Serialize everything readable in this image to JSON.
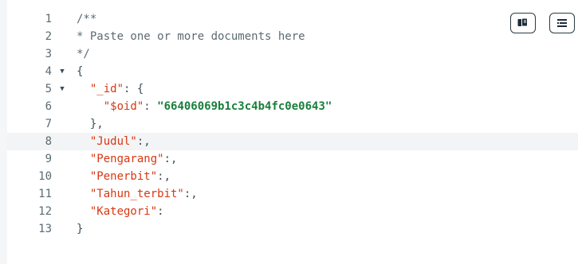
{
  "editor": {
    "active_line": 8,
    "lines": [
      {
        "num": "1",
        "fold": "",
        "parts": [
          {
            "t": "/**",
            "c": "cm"
          }
        ]
      },
      {
        "num": "2",
        "fold": "",
        "parts": [
          {
            "t": "* Paste one or more documents here",
            "c": "cm"
          }
        ]
      },
      {
        "num": "3",
        "fold": "",
        "parts": [
          {
            "t": "*/",
            "c": "cm"
          }
        ]
      },
      {
        "num": "4",
        "fold": "▼",
        "parts": [
          {
            "t": "{",
            "c": "punc"
          }
        ]
      },
      {
        "num": "5",
        "fold": "▼",
        "parts": [
          {
            "t": "  ",
            "c": "punc"
          },
          {
            "t": "\"_id\"",
            "c": "key"
          },
          {
            "t": ": {",
            "c": "punc"
          }
        ]
      },
      {
        "num": "6",
        "fold": "",
        "parts": [
          {
            "t": "    ",
            "c": "punc"
          },
          {
            "t": "\"$oid\"",
            "c": "key"
          },
          {
            "t": ": ",
            "c": "punc"
          },
          {
            "t": "\"66406069b1c3c4b4fc0e0643\"",
            "c": "str"
          }
        ]
      },
      {
        "num": "7",
        "fold": "",
        "parts": [
          {
            "t": "  },",
            "c": "punc"
          }
        ]
      },
      {
        "num": "8",
        "fold": "",
        "parts": [
          {
            "t": "  ",
            "c": "punc"
          },
          {
            "t": "\"Judul\"",
            "c": "key"
          },
          {
            "t": ":,",
            "c": "punc"
          }
        ]
      },
      {
        "num": "9",
        "fold": "",
        "parts": [
          {
            "t": "  ",
            "c": "punc"
          },
          {
            "t": "\"Pengarang\"",
            "c": "key"
          },
          {
            "t": ":,",
            "c": "punc"
          }
        ]
      },
      {
        "num": "10",
        "fold": "",
        "parts": [
          {
            "t": "  ",
            "c": "punc"
          },
          {
            "t": "\"Penerbit\"",
            "c": "key"
          },
          {
            "t": ":,",
            "c": "punc"
          }
        ]
      },
      {
        "num": "11",
        "fold": "",
        "parts": [
          {
            "t": "  ",
            "c": "punc"
          },
          {
            "t": "\"Tahun_terbit\"",
            "c": "key"
          },
          {
            "t": ":,",
            "c": "punc"
          }
        ]
      },
      {
        "num": "12",
        "fold": "",
        "parts": [
          {
            "t": "  ",
            "c": "punc"
          },
          {
            "t": "\"Kategori\"",
            "c": "key"
          },
          {
            "t": ":",
            "c": "punc"
          }
        ]
      },
      {
        "num": "13",
        "fold": "",
        "parts": [
          {
            "t": "}",
            "c": "punc"
          }
        ]
      }
    ]
  },
  "toolbar": {
    "copy_icon": "copy-icon",
    "format_icon": "format-icon"
  },
  "colors": {
    "key": "#d83713",
    "string": "#1a7f3c",
    "comment": "#5c6b73",
    "active_line_bg": "#f3f4f5"
  }
}
